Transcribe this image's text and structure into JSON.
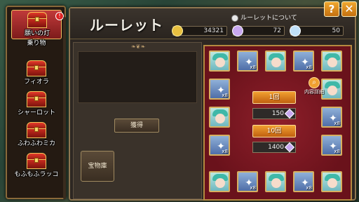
{
  "sidebar": {
    "items": [
      {
        "label": "願いの灯",
        "selected": true,
        "badge": "!"
      },
      {
        "label": "乗り物",
        "selected": false
      },
      {
        "label": "フィオラ",
        "selected": false
      },
      {
        "label": "シャーロット",
        "selected": false
      },
      {
        "label": "ふわふわミカ",
        "selected": false
      },
      {
        "label": "もふもふラッコ",
        "selected": false
      }
    ]
  },
  "header": {
    "title": "ルーレット",
    "about_label": "ルーレットについて",
    "currencies": [
      {
        "icon": "gold-coin-icon",
        "value": "34321"
      },
      {
        "icon": "wing-icon",
        "value": "72"
      },
      {
        "icon": "crystal-icon",
        "value": "50"
      }
    ],
    "help_label": "?",
    "close_label": "✕"
  },
  "left": {
    "acquire_label": "獲得",
    "vault_label": "宝物庫"
  },
  "board": {
    "spin1_label": "1回",
    "spin1_cost": "150",
    "spin10_label": "10回",
    "spin10_cost": "1400",
    "detail_label": "内容詳細",
    "slots": [
      {
        "kind": "char"
      },
      {
        "kind": "crys",
        "count": "x8"
      },
      {
        "kind": "char"
      },
      {
        "kind": "crys",
        "count": "x8"
      },
      {
        "kind": "char"
      },
      {
        "kind": "crys",
        "count": "x8"
      },
      {
        "kind": "char"
      },
      {
        "kind": "char"
      },
      {
        "kind": "crys",
        "count": "x8"
      },
      {
        "kind": "crys",
        "count": "x8"
      },
      {
        "kind": "crys",
        "count": "x8"
      },
      {
        "kind": "char"
      },
      {
        "kind": "crys",
        "count": "x8"
      },
      {
        "kind": "char"
      },
      {
        "kind": "crys",
        "count": "x8"
      },
      {
        "kind": "char"
      }
    ]
  },
  "colors": {
    "accent": "#f0a030",
    "board": "#7a1620",
    "frame": "#b48a40"
  }
}
